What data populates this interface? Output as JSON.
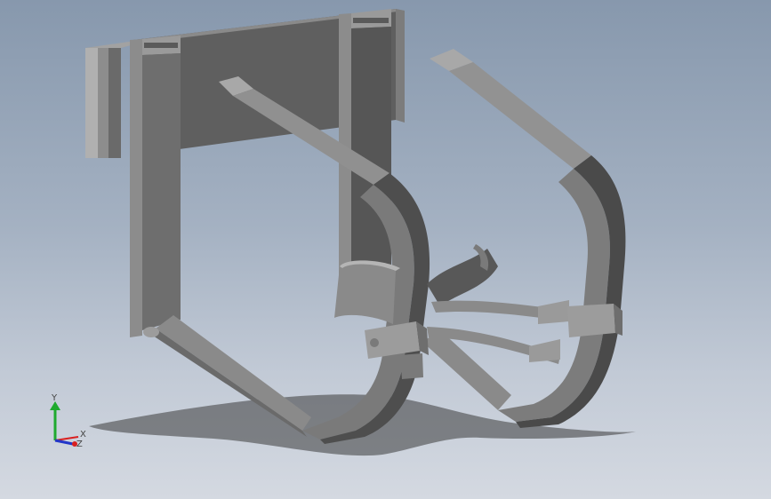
{
  "viewport": {
    "background_top": "#8798ad",
    "background_bottom": "#d4d9e1",
    "model_color": "#7a7a7a",
    "model_dark": "#4a4a4a",
    "model_light": "#9a9a9a"
  },
  "triad": {
    "x_label": "X",
    "y_label": "Y",
    "z_label": "Z",
    "x_color": "#d92020",
    "y_color": "#1faa2e",
    "z_color": "#2236c8"
  }
}
